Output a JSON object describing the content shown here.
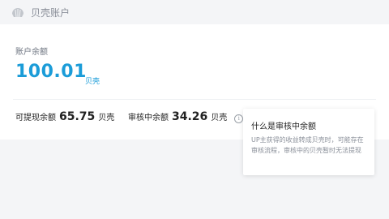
{
  "header": {
    "title": "贝壳账户"
  },
  "balance": {
    "label": "账户余额",
    "amount": "100.01",
    "unit": "贝壳"
  },
  "withdrawable": {
    "label": "可提现余额",
    "amount": "65.75",
    "unit": "贝壳"
  },
  "pending": {
    "label": "审核中余额",
    "amount": "34.26",
    "unit": "贝壳"
  },
  "tooltip": {
    "title": "什么是审核中余额",
    "body": "UP主获得的收益转成贝壳时，可能存在审核流程，审核中的贝壳暂时无法提现"
  },
  "colors": {
    "accent": "#1b9cd8",
    "background": "#f4f5f7"
  },
  "icons": {
    "header": "shell-icon",
    "pending": "info-icon"
  }
}
